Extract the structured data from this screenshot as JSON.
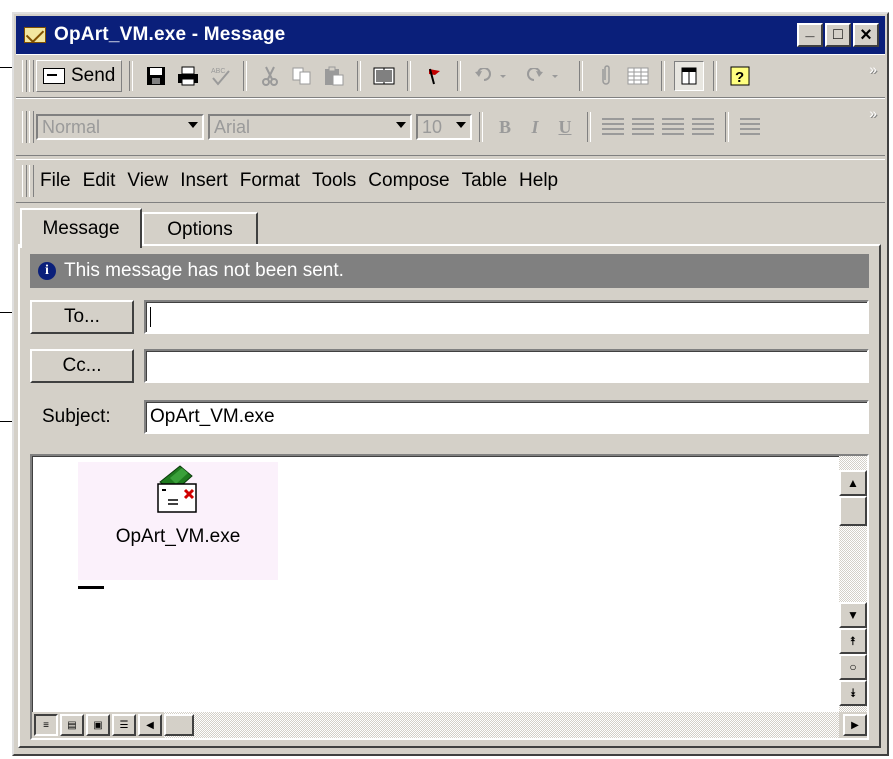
{
  "window": {
    "title": "OpArt_VM.exe - Message",
    "controls": {
      "minimize": "_",
      "maximize": "□",
      "close": "×"
    }
  },
  "toolbar": {
    "send_label": "Send",
    "icons": [
      "save-icon",
      "print-icon",
      "spellcheck-icon",
      "cut-icon",
      "copy-icon",
      "paste-icon",
      "address-book-icon",
      "flag-icon",
      "undo-icon",
      "redo-icon",
      "attach-icon",
      "table-icon",
      "options-icon",
      "help-icon"
    ]
  },
  "format_bar": {
    "style_value": "Normal",
    "font_value": "Arial",
    "size_value": "10",
    "bold": "B",
    "italic": "I",
    "underline": "U"
  },
  "menu": [
    "File",
    "Edit",
    "View",
    "Insert",
    "Format",
    "Tools",
    "Compose",
    "Table",
    "Help"
  ],
  "tabs": [
    "Message",
    "Options"
  ],
  "info_message": "This message has not been sent.",
  "recipients": {
    "to_label": "To...",
    "to_value": "",
    "cc_label": "Cc...",
    "cc_value": "",
    "subject_label": "Subject:",
    "subject_value": "OpArt_VM.exe"
  },
  "body": {
    "attachment_name": "OpArt_VM.exe"
  },
  "colors": {
    "title_bar": "#0a1f7a",
    "face": "#d4d0c8",
    "info_bar": "#808080",
    "attachment_bg": "#fbf1fb"
  }
}
